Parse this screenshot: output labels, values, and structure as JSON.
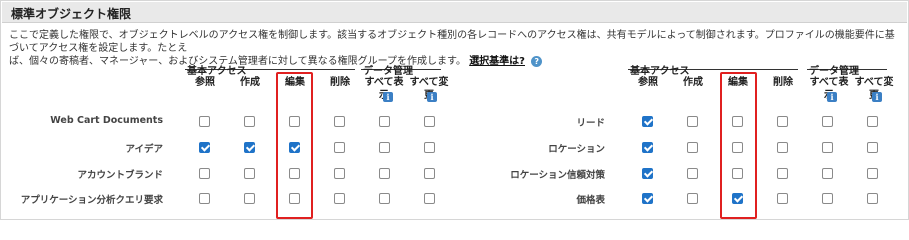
{
  "section": {
    "title": "標準オブジェクト権限"
  },
  "description": {
    "line1": "ここで定義した権限で、オブジェクトレベルのアクセス権を制御します。該当するオブジェクト種別の各レコードへのアクセス権は、共有モデルによって制御されます。プロファイルの機能要件に基づいてアクセス権を設定します。たとえ",
    "line2": "ば、個々の寄稿者、マネージャー、およびシステム管理者に対して異なる権限グループを作成します。",
    "link": "選択基準は?",
    "help_icon": "help-icon"
  },
  "groups": {
    "basic": "基本アクセス",
    "data": "データ管理"
  },
  "columns": {
    "read": "参照",
    "create": "作成",
    "edit": "編集",
    "delete": "削除",
    "view_all_1": "すべて表",
    "view_all_2": "示",
    "modify_all_1": "すべて変",
    "modify_all_2": "更",
    "info_icon": "i"
  },
  "left": {
    "rows": [
      {
        "label": "Web Cart Documents",
        "perms": [
          false,
          false,
          false,
          false,
          false,
          false
        ]
      },
      {
        "label": "アイデア",
        "perms": [
          true,
          true,
          true,
          false,
          false,
          false
        ]
      },
      {
        "label": "アカウントブランド",
        "perms": [
          false,
          false,
          false,
          false,
          false,
          false
        ]
      },
      {
        "label": "アプリケーション分析クエリ要求",
        "perms": [
          false,
          false,
          false,
          false,
          false,
          false
        ]
      }
    ]
  },
  "right": {
    "rows": [
      {
        "label": "リード",
        "perms": [
          true,
          false,
          false,
          false,
          false,
          false
        ]
      },
      {
        "label": "ロケーション",
        "perms": [
          true,
          false,
          false,
          false,
          false,
          false
        ]
      },
      {
        "label": "ロケーション信頼対策",
        "perms": [
          true,
          false,
          false,
          false,
          false,
          false
        ]
      },
      {
        "label": "価格表",
        "perms": [
          true,
          false,
          true,
          false,
          false,
          false
        ]
      }
    ]
  },
  "colors": {
    "checked": "#1f73c8",
    "highlight": "#e02020",
    "header_bg": "#e9e9e9"
  }
}
